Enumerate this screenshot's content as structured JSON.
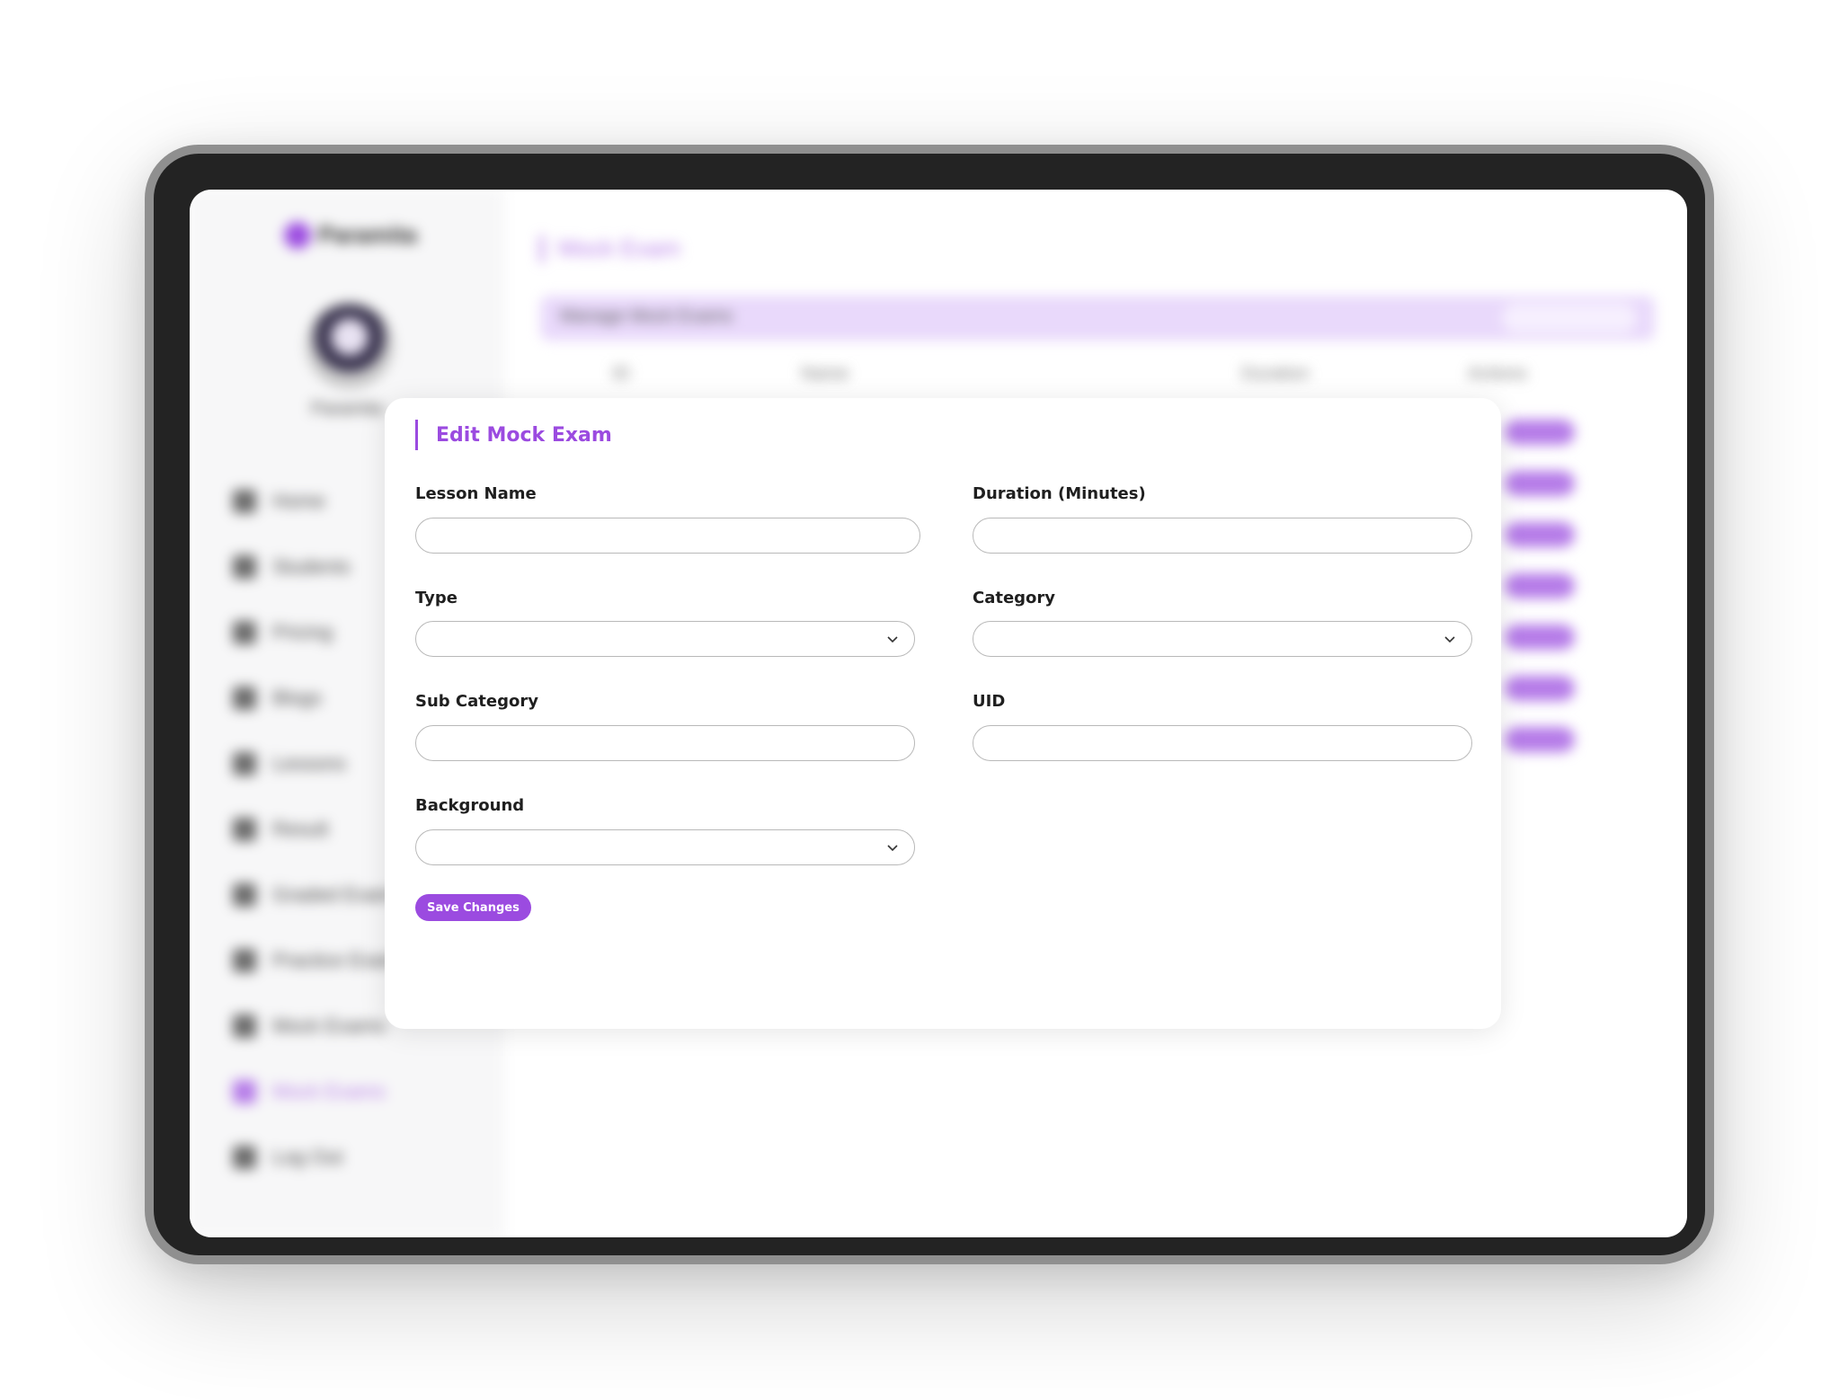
{
  "background_app": {
    "logo_text": "Paramita",
    "user_name": "Paramita",
    "nav_items": [
      {
        "label": "Home"
      },
      {
        "label": "Students"
      },
      {
        "label": "Pricing"
      },
      {
        "label": "Blogs"
      },
      {
        "label": "Lessons"
      },
      {
        "label": "Result"
      },
      {
        "label": "Graded Exams"
      },
      {
        "label": "Practice Exams"
      },
      {
        "label": "Mock Exams"
      },
      {
        "label": "Mock Exams",
        "active": true
      },
      {
        "label": "Log Out"
      }
    ],
    "page_title": "Mock Exam",
    "table_title": "Manage Mock Exams",
    "table_headers": [
      "ID",
      "Name",
      "Duration",
      "Actions"
    ]
  },
  "modal": {
    "title": "Edit Mock Exam",
    "fields": {
      "lesson_name": {
        "label": "Lesson Name",
        "value": ""
      },
      "duration": {
        "label": "Duration (Minutes)",
        "value": ""
      },
      "type": {
        "label": "Type",
        "value": ""
      },
      "category": {
        "label": "Category",
        "value": ""
      },
      "sub_category": {
        "label": "Sub Category",
        "value": ""
      },
      "uid": {
        "label": "UID",
        "value": ""
      },
      "background": {
        "label": "Background",
        "value": ""
      }
    },
    "save_label": "Save Changes"
  },
  "colors": {
    "accent": "#9b4be0",
    "accent_light": "#e9d9fb",
    "device_frame": "#232323"
  },
  "icons": {
    "select_chevron": "chevron-down-icon"
  }
}
